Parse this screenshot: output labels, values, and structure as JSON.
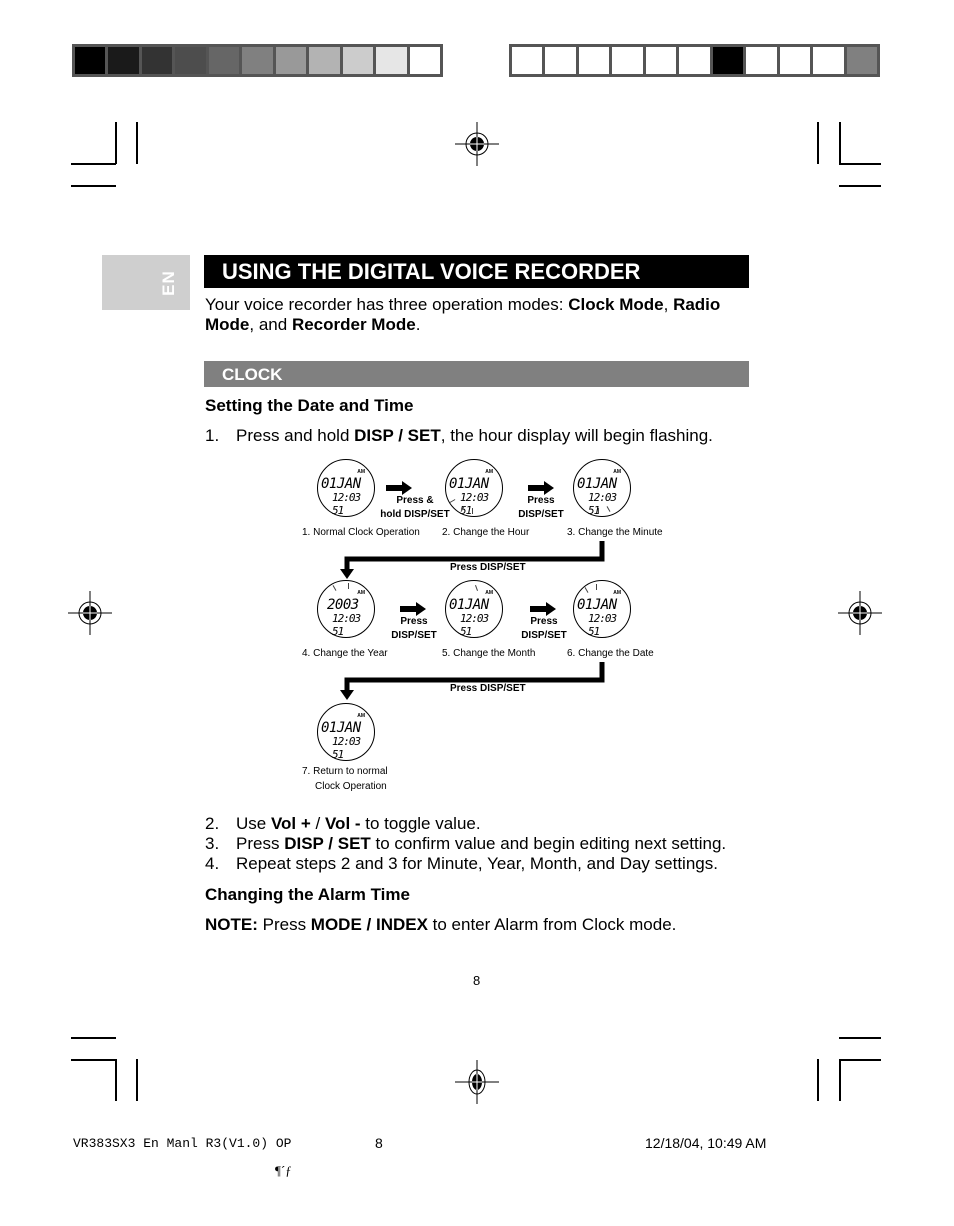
{
  "color_bars": {
    "left": [
      "#000000",
      "#1a1a1a",
      "#333333",
      "#4d4d4d",
      "#666666",
      "#808080",
      "#999999",
      "#b3b3b3",
      "#cccccc",
      "#e6e6e6",
      "#ffffff"
    ],
    "right": [
      "#ffffff",
      "#ffffff",
      "#ffffff",
      "#ffffff",
      "#ffffff",
      "#ffffff",
      "#000000",
      "#ffffff",
      "#ffffff",
      "#ffffff",
      "#808080"
    ]
  },
  "language_tab": "EN",
  "title": "USING THE DIGITAL VOICE RECORDER",
  "intro": {
    "text1": "Your voice recorder has three operation modes: ",
    "mode1": "Clock Mode",
    "sep1": ", ",
    "mode2": "Radio Mode",
    "sep2": ", and ",
    "mode3": "Recorder Mode",
    "end": "."
  },
  "section_title": "CLOCK",
  "subsection1": "Setting the Date and Time",
  "step1": {
    "num": "1.",
    "pre": "Press and hold ",
    "bold": "DISP / SET",
    "post": ", the hour display will begin flashing."
  },
  "diagram": {
    "displays": [
      {
        "line1": "01JAN",
        "line2": "12:03 51",
        "caption": "1. Normal Clock Operation"
      },
      {
        "line1": "01JAN",
        "line2": "12:03 51",
        "caption": "2. Change the Hour"
      },
      {
        "line1": "01JAN",
        "line2": "12:03 51",
        "caption": "3. Change the Minute"
      },
      {
        "line1": "2003",
        "line2": "12:03 51",
        "caption": "4. Change the Year"
      },
      {
        "line1": "01JAN",
        "line2": "12:03 51",
        "caption": "5. Change the Month"
      },
      {
        "line1": "01JAN",
        "line2": "12:03 51",
        "caption": "6. Change the Date"
      },
      {
        "line1": "01JAN",
        "line2": "12:03 51",
        "caption_line1": "7.  Return to normal",
        "caption_line2": "Clock Operation"
      }
    ],
    "am_label": "AM",
    "press_hold": {
      "line1": "Press &",
      "line2": "hold DISP/SET"
    },
    "press": {
      "line1": "Press",
      "line2": "DISP/SET"
    },
    "press_disp_set": "Press DISP/SET"
  },
  "steps": [
    {
      "num": "2.",
      "pre": "Use ",
      "bold1": "Vol +",
      "mid": " / ",
      "bold2": "Vol -",
      "post": " to toggle value."
    },
    {
      "num": "3.",
      "pre": "Press ",
      "bold1": "DISP / SET",
      "post": " to confirm value and begin editing next setting."
    },
    {
      "num": "4.",
      "text": "Repeat steps 2 and 3 for Minute, Year, Month, and Day settings."
    }
  ],
  "subsection2": "Changing the Alarm Time",
  "note": {
    "label": "NOTE:",
    "pre": " Press ",
    "bold": "MODE / INDEX",
    "post": " to enter Alarm from Clock mode."
  },
  "page_number": "8",
  "footer": {
    "code": "VR383SX3 En Manl R3(V1.0) OP",
    "page": "8",
    "date": "12/18/04, 10:49 AM",
    "symbol": "¶´ƒ"
  }
}
